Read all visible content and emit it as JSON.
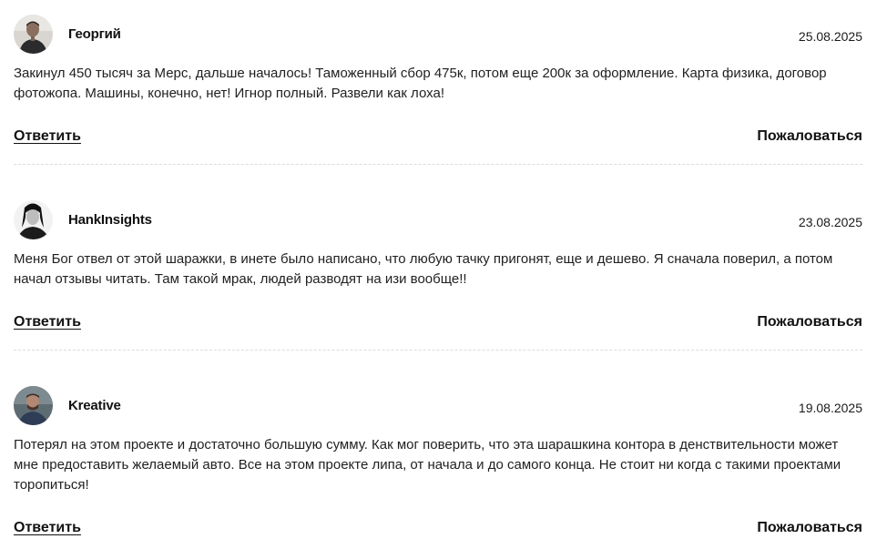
{
  "reviews": [
    {
      "author": "Георгий",
      "date": "25.08.2025",
      "text": "Закинул 450 тысяч за Мерс, дальше началось! Таможенный сбор 475к, потом еще 200к за оформление. Карта физика, договор фотожопа. Машины, конечно, нет! Игнор полный. Развели как лоха!",
      "reply_label": "Ответить",
      "report_label": "Пожаловаться"
    },
    {
      "author": "HankInsights",
      "date": "23.08.2025",
      "text": "Меня Бог отвел от этой шаражки, в инете было написано, что любую тачку пригонят, еще и дешево. Я сначала поверил, а потом начал отзывы читать. Там такой мрак, людей разводят на изи вообще!!",
      "reply_label": "Ответить",
      "report_label": "Пожаловаться"
    },
    {
      "author": "Kreative",
      "date": "19.08.2025",
      "text": "Потерял на этом проекте и достаточно большую сумму. Как мог поверить, что эта шарашкина контора в денствительности может мне предоставить желаемый авто. Все на этом проекте липа, от начала и до самого конца. Не стоит ни когда с такими проектами торопиться!",
      "reply_label": "Ответить",
      "report_label": "Пожаловаться"
    }
  ]
}
